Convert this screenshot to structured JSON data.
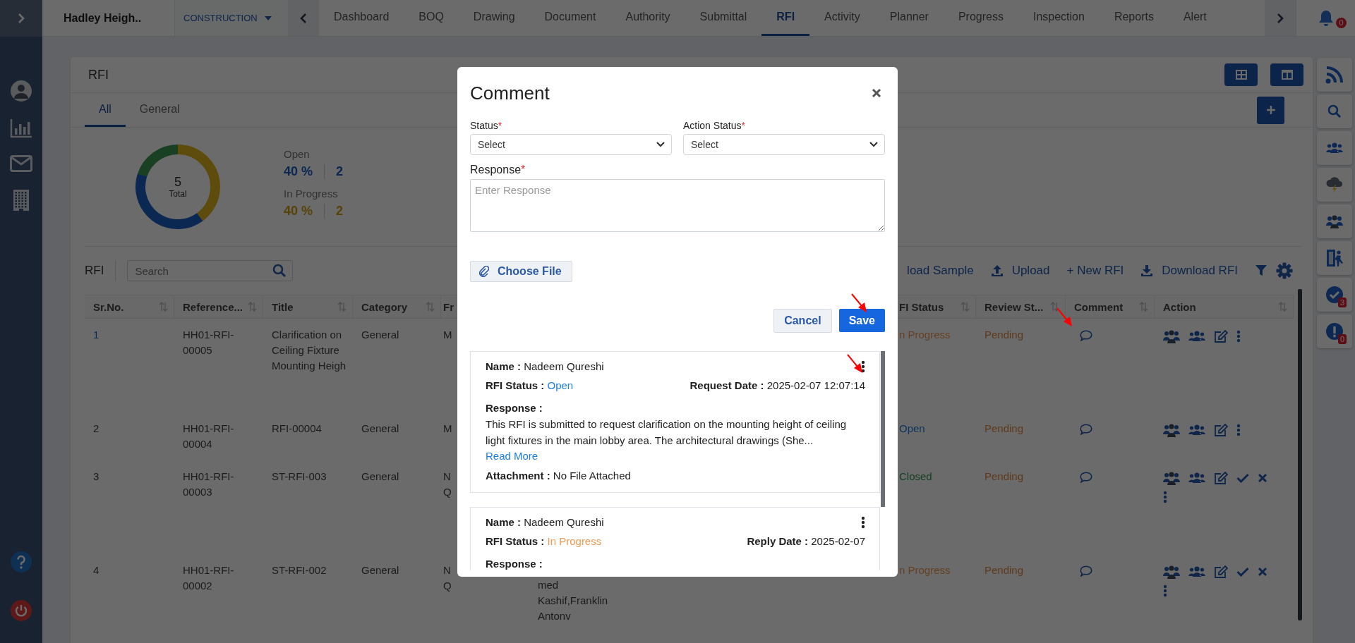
{
  "topbar": {
    "project": "Hadley Heigh..",
    "module": "CONSTRUCTION",
    "tabs": [
      {
        "label": "Dashboard",
        "selected": false
      },
      {
        "label": "BOQ",
        "selected": false
      },
      {
        "label": "Drawing",
        "selected": false
      },
      {
        "label": "Document",
        "selected": false
      },
      {
        "label": "Authority",
        "selected": false
      },
      {
        "label": "Submittal",
        "selected": false
      },
      {
        "label": "RFI",
        "selected": true
      },
      {
        "label": "Activity",
        "selected": false
      },
      {
        "label": "Planner",
        "selected": false
      },
      {
        "label": "Progress",
        "selected": false
      },
      {
        "label": "Inspection",
        "selected": false
      },
      {
        "label": "Reports",
        "selected": false
      },
      {
        "label": "Alert",
        "selected": false
      }
    ],
    "notifications": "0"
  },
  "sidebar": {
    "items": [
      {
        "kind": "avatar"
      },
      {
        "kind": "chart"
      },
      {
        "kind": "mail"
      },
      {
        "kind": "building"
      }
    ],
    "footer": [
      {
        "kind": "help"
      },
      {
        "kind": "power"
      }
    ]
  },
  "right_rail": [
    {
      "kind": "rss"
    },
    {
      "kind": "search"
    },
    {
      "kind": "users"
    },
    {
      "kind": "storm"
    },
    {
      "kind": "team"
    },
    {
      "kind": "exit"
    },
    {
      "kind": "check",
      "badge": "3"
    },
    {
      "kind": "info",
      "badge": "0"
    }
  ],
  "panel": {
    "title": "RFI",
    "tabs": [
      {
        "label": "All",
        "selected": true
      },
      {
        "label": "General",
        "selected": false
      }
    ]
  },
  "summary": {
    "total": "5",
    "total_label": "Total",
    "stats": [
      {
        "label": "Open",
        "percent": "40 %",
        "count": "2",
        "kind": "open"
      },
      {
        "label": "In Progress",
        "percent": "40 %",
        "count": "2",
        "kind": "progress"
      }
    ]
  },
  "toolbar": {
    "title": "RFI",
    "search_placeholder": "Search",
    "actions": [
      {
        "label": "load Sample",
        "kind": "plain"
      },
      {
        "label": "Upload",
        "kind": "upload"
      },
      {
        "label": "+ New RFI",
        "kind": "plain"
      },
      {
        "label": "Download RFI",
        "kind": "download"
      }
    ]
  },
  "table": {
    "columns": [
      {
        "label": "Sr.No.",
        "sortable": true
      },
      {
        "label": "Reference...",
        "sortable": true
      },
      {
        "label": "Title",
        "sortable": true
      },
      {
        "label": "Category",
        "sortable": true
      },
      {
        "label": "Fr",
        "sortable": false
      },
      {
        "label": "FI Status",
        "sortable": true
      },
      {
        "label": "Review St...",
        "sortable": true
      },
      {
        "label": "Comment",
        "sortable": true
      },
      {
        "label": "Action",
        "sortable": true
      }
    ],
    "rows": [
      {
        "selected": true,
        "sr": "1",
        "reference": "HH01-RFI-00005",
        "title": "Clarification on Ceiling Fixture Mounting Heigh",
        "category": "General",
        "from": "M",
        "rfi_status": "n Progress",
        "kind": "progress",
        "review": "Pending",
        "approvable": false
      },
      {
        "selected": false,
        "sr": "2",
        "reference": "HH01-RFI-00004",
        "title": "RFI-00004",
        "category": "General",
        "from": "M",
        "rfi_status": "Open",
        "kind": "open",
        "review": "Pending",
        "approvable": false
      },
      {
        "selected": false,
        "sr": "3",
        "reference": "HH01-RFI-00003",
        "title": "ST-RFI-003",
        "category": "General",
        "from": "N\nQ",
        "rfi_status": "Closed",
        "kind": "closed",
        "review": "Pending",
        "approvable": true
      },
      {
        "selected": false,
        "sr": "4",
        "reference": "HH01-RFI-00002",
        "title": "ST-RFI-002",
        "category": "General",
        "from": "N\nQ",
        "column_6": "med Kashif,Franklin Antonv",
        "rfi_status": "n Progress",
        "kind": "progress",
        "review": "Pending",
        "approvable": true
      }
    ]
  },
  "dialog": {
    "title": "Comment",
    "fields": [
      {
        "label": "Status",
        "mark": "*",
        "value": "Select"
      },
      {
        "label": "Action Status",
        "mark": "*",
        "value": "Select"
      }
    ],
    "response": {
      "label": "Response",
      "mark": "*",
      "placeholder": "Enter Response"
    },
    "file_button": "Choose File",
    "cancel": "Cancel",
    "save": "Save",
    "comments": [
      {
        "name_label": "Name :",
        "name": "Nadeem Qureshi",
        "status_label": "RFI Status :",
        "status": "Open",
        "color": "#1f7fe0",
        "date_label": "Request Date :",
        "date": "2025-02-07 12:07:14",
        "response_label": "Response :",
        "response": "This RFI is submitted to request clarification on the mounting height of ceiling light fixtures in the main lobby area. The architectural drawings (She...",
        "read_more": "Read More",
        "attachment_label": "Attachment :",
        "attachment": "No File Attached"
      },
      {
        "name_label": "Name :",
        "name": "Nadeem Qureshi",
        "status_label": "RFI Status :",
        "status": "In Progress",
        "color": "#ef9a52",
        "date_label": "Reply Date :",
        "date": "2025-02-07",
        "response_label": "Response :"
      }
    ]
  }
}
